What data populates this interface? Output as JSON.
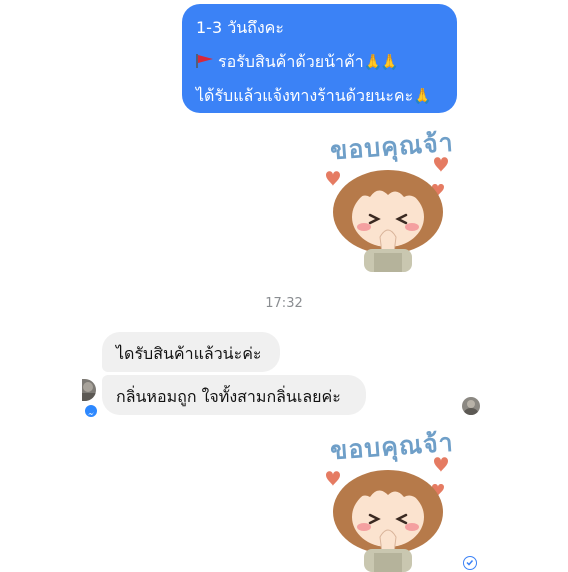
{
  "messages": {
    "outgoing": {
      "line1": "1-3 วันถึงคะ",
      "line2": "รอรับสินค้าด้วยน้าค้า",
      "line2_emoji": "🙏🙏",
      "line3": "ได้รับแล้วแจ้งทางร้านด้วยนะคะ",
      "line3_emoji": "🙏",
      "bubble_color": "#3b82f6"
    },
    "sticker_text": "ขอบคุณจ้า",
    "timestamp": "17:32",
    "incoming": [
      "ไดรับสินค้าแล้วน่ะค่ะ",
      "กลิ่นหอมถูก ใจทั้งสามกลิ่นเลยค่ะ"
    ],
    "incoming_bubble_color": "#f0f0f0"
  },
  "icons": {
    "flag": "red-triangle-flag-icon",
    "pray": "folded-hands-icon",
    "messenger_badge": "messenger-icon",
    "sent_check": "check-circle-icon"
  }
}
